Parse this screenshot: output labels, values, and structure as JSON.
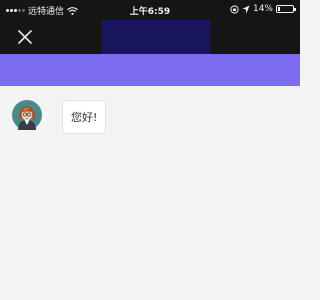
{
  "status_bar": {
    "carrier": "远特通信",
    "time": "上午6:59",
    "battery": "14%",
    "battery_level": 0.14
  },
  "nav": {
    "close_icon": "close-icon"
  },
  "chat": {
    "messages": [
      {
        "sender": "bot",
        "avatar_icon": "female-avatar-icon",
        "text": "您好!"
      }
    ]
  },
  "colors": {
    "status_bar_bg": "#151515",
    "nav_bg": "#161616",
    "nav_title_block": "#19155e",
    "header_band": "#7c6cf0",
    "chat_bg": "#f4f4f4",
    "bubble_bg": "#ffffff"
  }
}
